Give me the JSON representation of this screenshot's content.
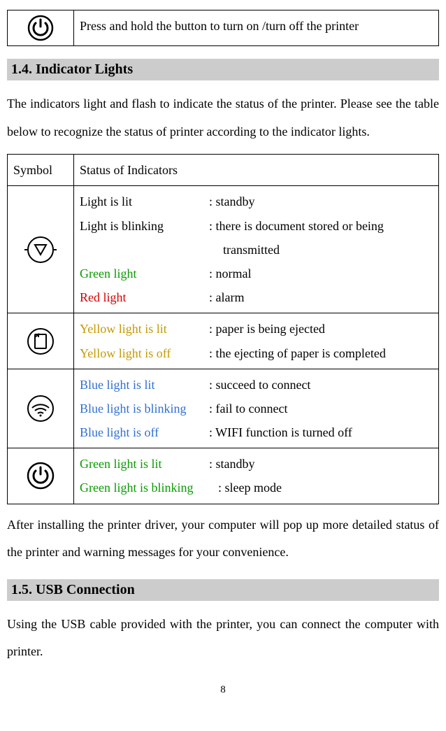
{
  "top_table": {
    "desc": "Press and hold the button to turn on /turn off the printer"
  },
  "section_14_heading": "1.4.   Indicator Lights",
  "para_14": "The indicators light and flash to indicate the status of the printer. Please see the table below to recognize the status of printer according to the indicator lights.",
  "indicator_table": {
    "col1": "Symbol",
    "col2": "Status of Indicators",
    "row1": {
      "l1_label": "Light is lit",
      "l1_val": ": standby",
      "l2_label": "Light is blinking",
      "l2_val": ": there is document stored or being",
      "l2_cont": "transmitted",
      "l3_label": "Green light",
      "l3_val": ": normal",
      "l4_label": "Red light",
      "l4_val": ": alarm"
    },
    "row2": {
      "l1_label": "Yellow light is lit",
      "l1_val": ": paper is being ejected",
      "l2_label": "Yellow light is off",
      "l2_val": ": the ejecting of paper is completed"
    },
    "row3": {
      "l1_label": "Blue light is lit",
      "l1_val": ": succeed to connect",
      "l2_label": "Blue light is blinking",
      "l2_val": ": fail to connect",
      "l3_label": "Blue light is off",
      "l3_val": ": WIFI function is turned off"
    },
    "row4": {
      "l1_label": "Green light is lit",
      "l1_val": ": standby",
      "l2_label": "Green light is blinking",
      "l2_val": ": sleep mode"
    }
  },
  "para_after": "After installing the printer driver, your computer will pop up more detailed status of the printer and warning messages for your convenience.",
  "section_15_heading": "1.5.   USB Connection",
  "para_15": "Using the USB cable provided with the printer, you can connect the computer with printer.",
  "page_number": "8"
}
